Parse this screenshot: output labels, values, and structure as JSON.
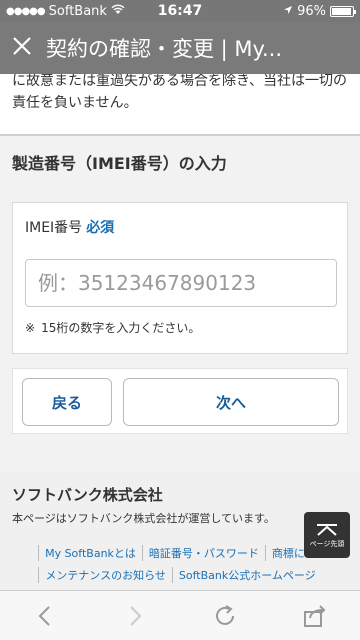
{
  "status_bar": {
    "carrier": "SoftBank",
    "time": "16:47",
    "battery": "96%",
    "battery_level": 0.96
  },
  "title_bar": {
    "close_icon": "close-icon",
    "title": "契約の確認・変更 | My..."
  },
  "page": {
    "disclaimer": "に故意または重過失がある場合を除き、当社は一切の責任を負いません。",
    "section_title": "製造番号（IMEI番号）の入力",
    "imei": {
      "label": "IMEI番号",
      "required": "必須",
      "placeholder": "例：35123467890123",
      "note_mark": "※",
      "note": "15桁の数字を入力ください。"
    },
    "buttons": {
      "back": "戻る",
      "next": "次へ"
    }
  },
  "footer": {
    "company": "ソフトバンク株式会社",
    "description": "本ページはソフトバンク株式会社が運営しています。",
    "links_row1": [
      "My SoftBankとは",
      "暗証番号・パスワード",
      "商標につ"
    ],
    "links_row2": [
      "メンテナンスのお知らせ",
      "SoftBank公式ホームページ"
    ],
    "page_top_label": "ページ先頭"
  },
  "toolbar": {
    "icons": [
      "back-arrow-icon",
      "forward-arrow-icon",
      "reload-icon",
      "share-icon"
    ]
  }
}
